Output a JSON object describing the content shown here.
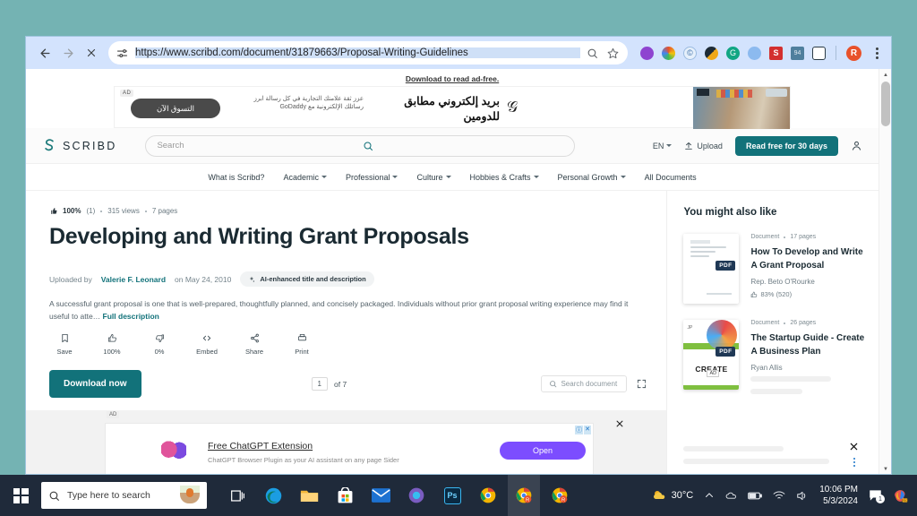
{
  "browser": {
    "back_label": "←",
    "forward_label": "→",
    "stop_label": "✕",
    "url": "https://www.scribd.com/document/31879663/Proposal-Writing-Guidelines",
    "site_settings_icon": "tune-icon",
    "search_icon": "search-icon",
    "bookmark_icon": "star-icon",
    "profile_initial": "R",
    "extensions": [
      {
        "name": "extension-purple",
        "color": "#8e44d0"
      },
      {
        "name": "extension-colorwheel",
        "color": "#e8512a"
      },
      {
        "name": "extension-copyright",
        "color": "#e6f0fb"
      },
      {
        "name": "extension-grammarly-dark",
        "color": "#1d2b36"
      },
      {
        "name": "extension-grammarly",
        "color": "#11a683"
      },
      {
        "name": "extension-globe",
        "color": "#4a90e2"
      },
      {
        "name": "extension-s-red",
        "color": "#d32f2f"
      },
      {
        "name": "extension-calendar",
        "color": "#4f7f9d"
      },
      {
        "name": "extension-clipboard",
        "color": "#2b3a45"
      }
    ]
  },
  "top_ad": {
    "download_link": "Download to read ad-free.",
    "ad_label": "AD",
    "cta": "التسوق الآن",
    "subtext": "عزز ثقة علامتك التجارية في كل رسالة ابرز رسائلك الإلكترونية مع GoDaddy",
    "headline": "بريد إلكتروني مطابق للدومين",
    "logo": "𝒢"
  },
  "scribd_header": {
    "brand": "SCRIBD",
    "brand_mark": "scribd-logo-icon",
    "search_placeholder": "Search",
    "search_icon": "search-icon",
    "language": "EN",
    "upload_label": "Upload",
    "upload_icon": "upload-icon",
    "cta": "Read free for 30 days",
    "account_icon": "account-icon"
  },
  "scribd_nav": {
    "items": [
      {
        "label": "What is Scribd?",
        "caret": false
      },
      {
        "label": "Academic",
        "caret": true
      },
      {
        "label": "Professional",
        "caret": true
      },
      {
        "label": "Culture",
        "caret": true
      },
      {
        "label": "Hobbies & Crafts",
        "caret": true
      },
      {
        "label": "Personal Growth",
        "caret": true
      },
      {
        "label": "All Documents",
        "caret": false
      }
    ]
  },
  "document": {
    "rating_percent": "100%",
    "rating_count": "(1)",
    "views": "315 views",
    "pages": "7 pages",
    "title": "Developing and Writing Grant Proposals",
    "uploaded_prefix": "Uploaded by",
    "uploader": "Valerie F. Leonard",
    "uploaded_suffix": "on May 24, 2010",
    "ai_chip": "AI-enhanced title and description",
    "ai_chip_icon": "sparkle-icon",
    "description": "A successful grant proposal is one that is well-prepared, thoughtfully planned, and concisely packaged. Individuals without prior grant proposal writing experience may find it useful to atte…",
    "full_description_link": "Full description",
    "actions": [
      {
        "icon": "bookmark-icon",
        "glyph": "☐",
        "label": "Save"
      },
      {
        "icon": "thumbs-up-icon",
        "glyph": "☚",
        "label": "100%"
      },
      {
        "icon": "thumbs-down-icon",
        "glyph": "☛",
        "label": "0%"
      },
      {
        "icon": "code-icon",
        "glyph": "<>",
        "label": "Embed"
      },
      {
        "icon": "share-icon",
        "glyph": "∴",
        "label": "Share"
      },
      {
        "icon": "print-icon",
        "glyph": "⎙",
        "label": "Print"
      }
    ],
    "download_button": "Download now",
    "page_current": "1",
    "page_total": "of 7",
    "doc_search_placeholder": "Search document",
    "doc_search_icon": "search-icon",
    "fullscreen_icon": "fullscreen-icon"
  },
  "bottom_ad": {
    "ad_label": "AD",
    "title": "Free ChatGPT Extension",
    "subtitle": "ChatGPT Browser Plugin as your AI assistant on any page Sider",
    "button": "Open",
    "close_icon": "close-icon",
    "info_icon": "info-icon",
    "dismiss_icon": "x-icon"
  },
  "rail": {
    "title": "You might also like",
    "items": [
      {
        "type": "Document",
        "pages": "17 pages",
        "name": "How To Develop and Write A Grant Proposal",
        "author": "Rep. Beto O'Rourke",
        "rating": "83% (520)",
        "badge": "PDF",
        "thumb": "document-thumbnail"
      },
      {
        "type": "Document",
        "pages": "26 pages",
        "name": "The Startup Guide - Create A Business Plan",
        "author": "Ryan Allis",
        "rating": "",
        "badge": "PDF",
        "ad_tag": "AD",
        "thumb": "startup-guide-thumbnail"
      }
    ],
    "close_icon": "close-icon",
    "more_icon": "more-vertical-icon"
  },
  "taskbar": {
    "start_icon": "windows-start-icon",
    "search_placeholder": "Type here to search",
    "search_icon": "search-icon",
    "apps": [
      {
        "name": "task-view-icon",
        "glyph": "▣",
        "color": "#ffffff"
      },
      {
        "name": "edge-icon",
        "glyph": "",
        "color": "#1b9de2"
      },
      {
        "name": "file-explorer-icon",
        "glyph": "",
        "color": "#f3b63a"
      },
      {
        "name": "microsoft-store-icon",
        "glyph": "",
        "color": "#ffffff"
      },
      {
        "name": "mail-icon",
        "glyph": "",
        "color": "#1d72d1"
      },
      {
        "name": "office-icon",
        "glyph": "",
        "color": "#7a5cc0"
      },
      {
        "name": "photoshop-icon",
        "glyph": "Ps",
        "color": "#0a2a42"
      },
      {
        "name": "chrome-icon",
        "glyph": "",
        "color": "#f4b400"
      },
      {
        "name": "chrome-r-icon-active",
        "glyph": "",
        "color": "#f4b400"
      },
      {
        "name": "chrome-r-icon",
        "glyph": "",
        "color": "#f4b400"
      }
    ],
    "weather_temp": "30°C",
    "weather_icon": "partly-sunny-icon",
    "chevron_icon": "chevron-up-icon",
    "tray": [
      {
        "name": "onedrive-icon",
        "glyph": "☁"
      },
      {
        "name": "battery-icon",
        "glyph": "▭"
      },
      {
        "name": "wifi-icon",
        "glyph": "◠"
      },
      {
        "name": "volume-icon",
        "glyph": "◁"
      }
    ],
    "time": "10:06 PM",
    "date": "5/3/2024",
    "notification_count": "1",
    "notification_icon": "notification-icon",
    "app_icon": "copilot-icon"
  },
  "colors": {
    "accent_teal": "#12727a",
    "toolbar_blue": "#d3e3fd",
    "taskbar": "#1f2a3a",
    "desktop": "#74b3b3"
  }
}
